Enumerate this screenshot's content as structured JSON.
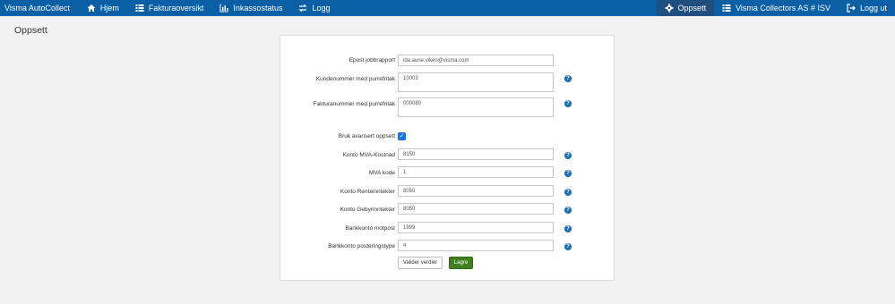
{
  "topbar": {
    "brand": "Visma AutoCollect",
    "nav": [
      {
        "icon": "home-icon",
        "label": "Hjem"
      },
      {
        "icon": "list-icon",
        "label": "Fakturaoversikt"
      },
      {
        "icon": "bar-chart-icon",
        "label": "Inkassostatus"
      },
      {
        "icon": "swap-icon",
        "label": "Logg"
      }
    ],
    "right": [
      {
        "icon": "gear-icon",
        "label": "Oppsett"
      },
      {
        "icon": "list-icon",
        "label": "Visma Collectors AS # ISV"
      },
      {
        "icon": "logout-icon",
        "label": "Logg ut"
      }
    ]
  },
  "page": {
    "title": "Oppsett"
  },
  "form": {
    "fields": [
      {
        "label": "Epost jobbrapport",
        "value": "ida.aune.viken@visma.com"
      },
      {
        "label": "Kundenummer med purrefritak",
        "value": "10003"
      },
      {
        "label": "Fakturanummer med purrefritak",
        "value": "000080"
      },
      {
        "label": "Bruk avansert oppsett"
      },
      {
        "label": "Konto MVA-Kostnad",
        "value": "8150"
      },
      {
        "label": "MVA kode",
        "value": "1"
      },
      {
        "label": "Konto Renteinntekter",
        "value": "8050"
      },
      {
        "label": "Konto Gebyrinntekter",
        "value": "8050"
      },
      {
        "label": "Bankkonto motpost",
        "value": "1999"
      },
      {
        "label": "Bankkonto posteringstype",
        "value": "4"
      }
    ],
    "help_glyph": "?",
    "checkbox_glyph": "✓",
    "buttons": {
      "validate": "Valider verdier",
      "save": "Lagre"
    }
  }
}
